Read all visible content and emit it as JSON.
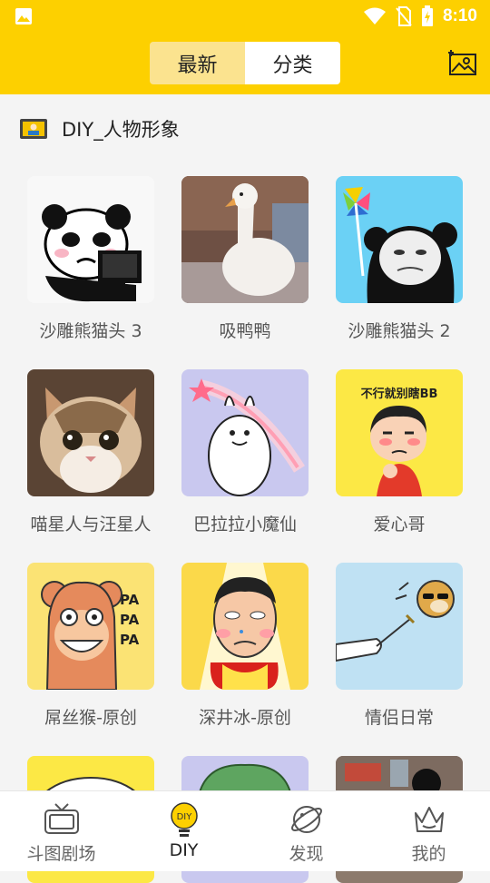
{
  "status_bar": {
    "time": "8:10"
  },
  "header": {
    "tabs": [
      {
        "label": "最新",
        "active": true
      },
      {
        "label": "分类",
        "active": false
      }
    ]
  },
  "section": {
    "title": "DIY_人物形象"
  },
  "grid": {
    "items": [
      {
        "label": "沙雕熊猫头 3"
      },
      {
        "label": "吸鸭鸭"
      },
      {
        "label": "沙雕熊猫头 2"
      },
      {
        "label": "喵星人与汪星人"
      },
      {
        "label": "巴拉拉小魔仙"
      },
      {
        "label": "爱心哥"
      },
      {
        "label": "屌丝猴-原创"
      },
      {
        "label": "深井冰-原创"
      },
      {
        "label": "情侣日常"
      }
    ],
    "thumb_texts": {
      "aixinge": "不行就别瞎BB",
      "monkey": "PA PA PA"
    }
  },
  "tabbar": {
    "items": [
      {
        "label": "斗图剧场",
        "icon": "tv-icon"
      },
      {
        "label": "DIY",
        "icon": "diy-bulb-icon"
      },
      {
        "label": "发现",
        "icon": "planet-icon"
      },
      {
        "label": "我的",
        "icon": "crown-icon"
      }
    ]
  },
  "colors": {
    "accent": "#fdd000",
    "tab_active": "#fbe38f"
  }
}
